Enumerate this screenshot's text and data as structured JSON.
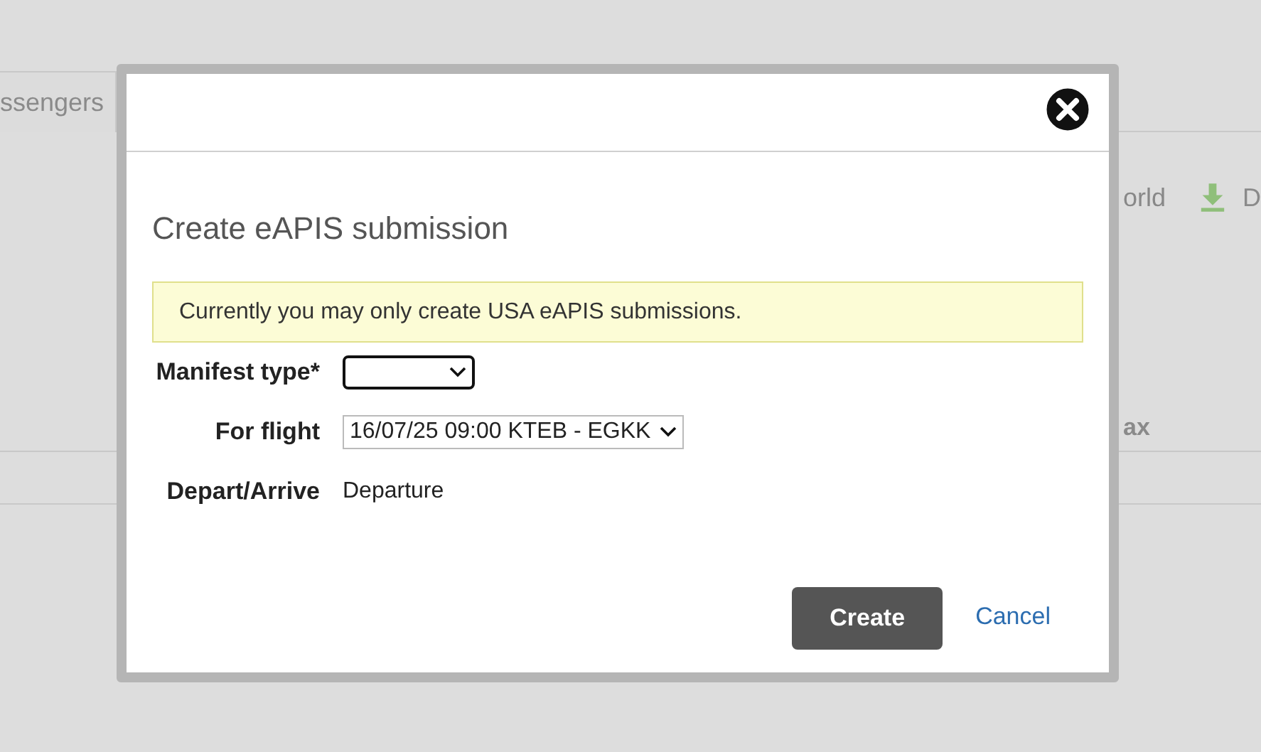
{
  "background": {
    "tab": "ssengers",
    "toolbar_link": "orld",
    "toolbar_link_2": "D",
    "column_header": "ax"
  },
  "dialog": {
    "title": "Create eAPIS submission",
    "notice": "Currently you may only create USA eAPIS submissions.",
    "fields": [
      {
        "kind": "select",
        "label": "Manifest type*",
        "focused": true
      },
      {
        "kind": "select",
        "label": "For flight",
        "value": "16/07/25 09:00 KTEB - EGKK",
        "focused": false
      },
      {
        "kind": "text",
        "label": "Depart/Arrive",
        "value": "Departure"
      }
    ],
    "buttons": [
      {
        "kind": "primary",
        "label": "Create"
      },
      {
        "kind": "link",
        "label": "Cancel"
      }
    ]
  }
}
